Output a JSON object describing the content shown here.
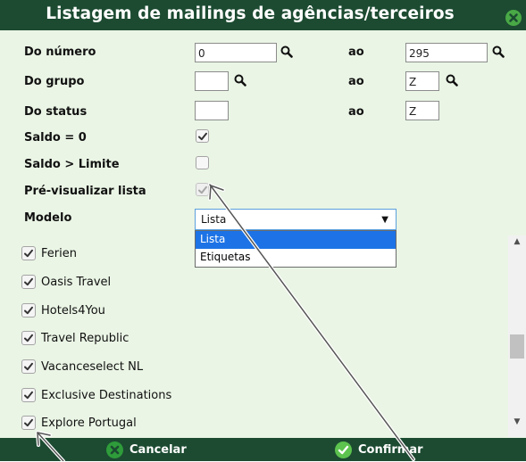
{
  "dialog": {
    "title": "Listagem de mailings de agências/terceiros",
    "close_icon": "close-icon"
  },
  "form": {
    "numero": {
      "label": "Do número",
      "from": "0",
      "to_label": "ao",
      "to": "295"
    },
    "grupo": {
      "label": "Do grupo",
      "from": "",
      "to_label": "ao",
      "to": "Z"
    },
    "status": {
      "label": "Do status",
      "from": "",
      "to_label": "ao",
      "to": "Z"
    },
    "saldo_zero": {
      "label": "Saldo = 0",
      "checked": true
    },
    "saldo_limite": {
      "label": "Saldo > Limite",
      "checked": false
    },
    "pre_visualizar": {
      "label": "Pré-visualizar lista",
      "checked": true,
      "disabled": true
    },
    "modelo": {
      "label": "Modelo",
      "value": "Lista",
      "options": [
        "Lista",
        "Etiquetas"
      ]
    }
  },
  "agencies": [
    {
      "name": "Ferien",
      "checked": true
    },
    {
      "name": "Oasis Travel",
      "checked": true
    },
    {
      "name": "Hotels4You",
      "checked": true
    },
    {
      "name": "Travel Republic",
      "checked": true
    },
    {
      "name": "Vacanceselect NL",
      "checked": true
    },
    {
      "name": "Exclusive Destinations",
      "checked": true
    },
    {
      "name": "Explore Portugal",
      "checked": true
    }
  ],
  "footer": {
    "cancel_label": "Cancelar",
    "confirm_label": "Confirmar"
  },
  "colors": {
    "header_bg": "#1c4b31",
    "body_bg": "#eaf5e5",
    "accent_green": "#49a946",
    "cancel_green": "#2e9c3a",
    "confirm_green": "#5cc34e",
    "select_blue": "#1d73e6"
  }
}
